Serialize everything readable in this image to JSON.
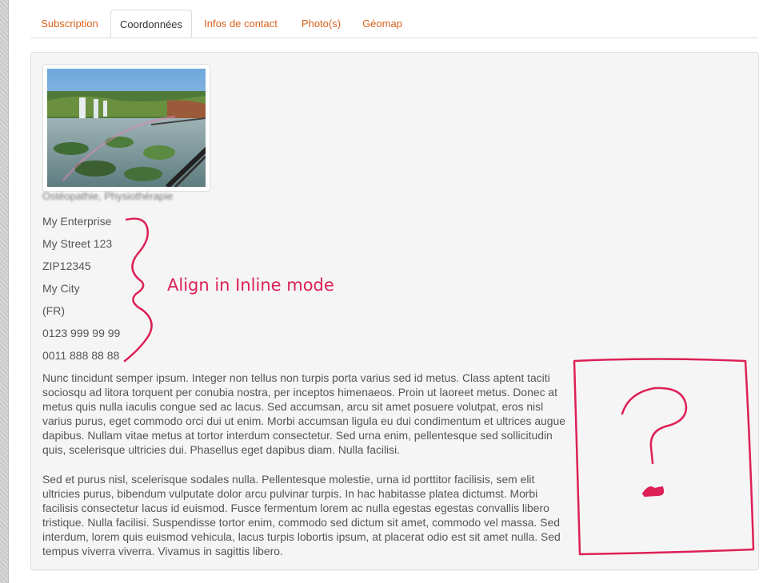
{
  "tabs": [
    {
      "label": "Subscription",
      "active": false
    },
    {
      "label": "Coordonnées",
      "active": true
    },
    {
      "label": "Infos de contact",
      "active": false
    },
    {
      "label": "Photo(s)",
      "active": false
    },
    {
      "label": "Géomap",
      "active": false
    }
  ],
  "profile": {
    "caption": "Ostéopathie, Physiothérapie",
    "address": {
      "enterprise": "My Enterprise",
      "street": "My Street 123",
      "zip": "ZIP12345",
      "city": "My City",
      "country": "(FR)",
      "phone": "0123 999 99 99",
      "fax": "0011 888 88 88"
    }
  },
  "description": {
    "paragraph1": "Nunc tincidunt semper ipsum. Integer non tellus non turpis porta varius sed id metus. Class aptent taciti sociosqu ad litora torquent per conubia nostra, per inceptos himenaeos. Proin ut laoreet metus. Donec at metus quis nulla iaculis congue sed ac lacus. Sed accumsan, arcu sit amet posuere volutpat, eros nisl varius purus, eget commodo orci dui ut enim. Morbi accumsan ligula eu dui condimentum et ultrices augue dapibus. Nullam vitae metus at tortor interdum consectetur. Sed urna enim, pellentesque sed sollicitudin quis, scelerisque ultricies dui. Phasellus eget dapibus diam. Nulla facilisi.",
    "paragraph2": "Sed et purus nisl, scelerisque sodales nulla. Pellentesque molestie, urna id porttitor facilisis, sem elit ultricies purus, bibendum vulputate dolor arcu pulvinar turpis. In hac habitasse platea dictumst. Morbi facilisis consectetur lacus id euismod. Fusce fermentum lorem ac nulla egestas egestas convallis libero tristique. Nulla facilisi. Suspendisse tortor enim, commodo sed dictum sit amet, commodo vel massa. Sed interdum, lorem quis euismod vehicula, lacus turpis lobortis ipsum, at placerat odio est sit amet nulla. Sed tempus viverra viverra. Vivamus in sagittis libero."
  },
  "annotation": {
    "text": "Align in Inline mode",
    "color": "#dd2056"
  },
  "colors": {
    "tab_link": "#d9601b",
    "text": "#555555",
    "panel_bg": "#f5f5f5"
  }
}
